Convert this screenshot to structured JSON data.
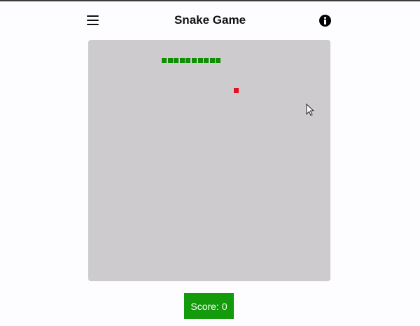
{
  "header": {
    "title": "Snake Game",
    "menu_icon": "hamburger-menu-icon",
    "info_icon": "info-icon"
  },
  "board": {
    "color": "#cdcbcd",
    "snake_color": "#118e06",
    "snake_length": 10,
    "food_color": "#e1121d"
  },
  "score": {
    "label": "Score:",
    "value": "0",
    "color": "#139b0c"
  }
}
